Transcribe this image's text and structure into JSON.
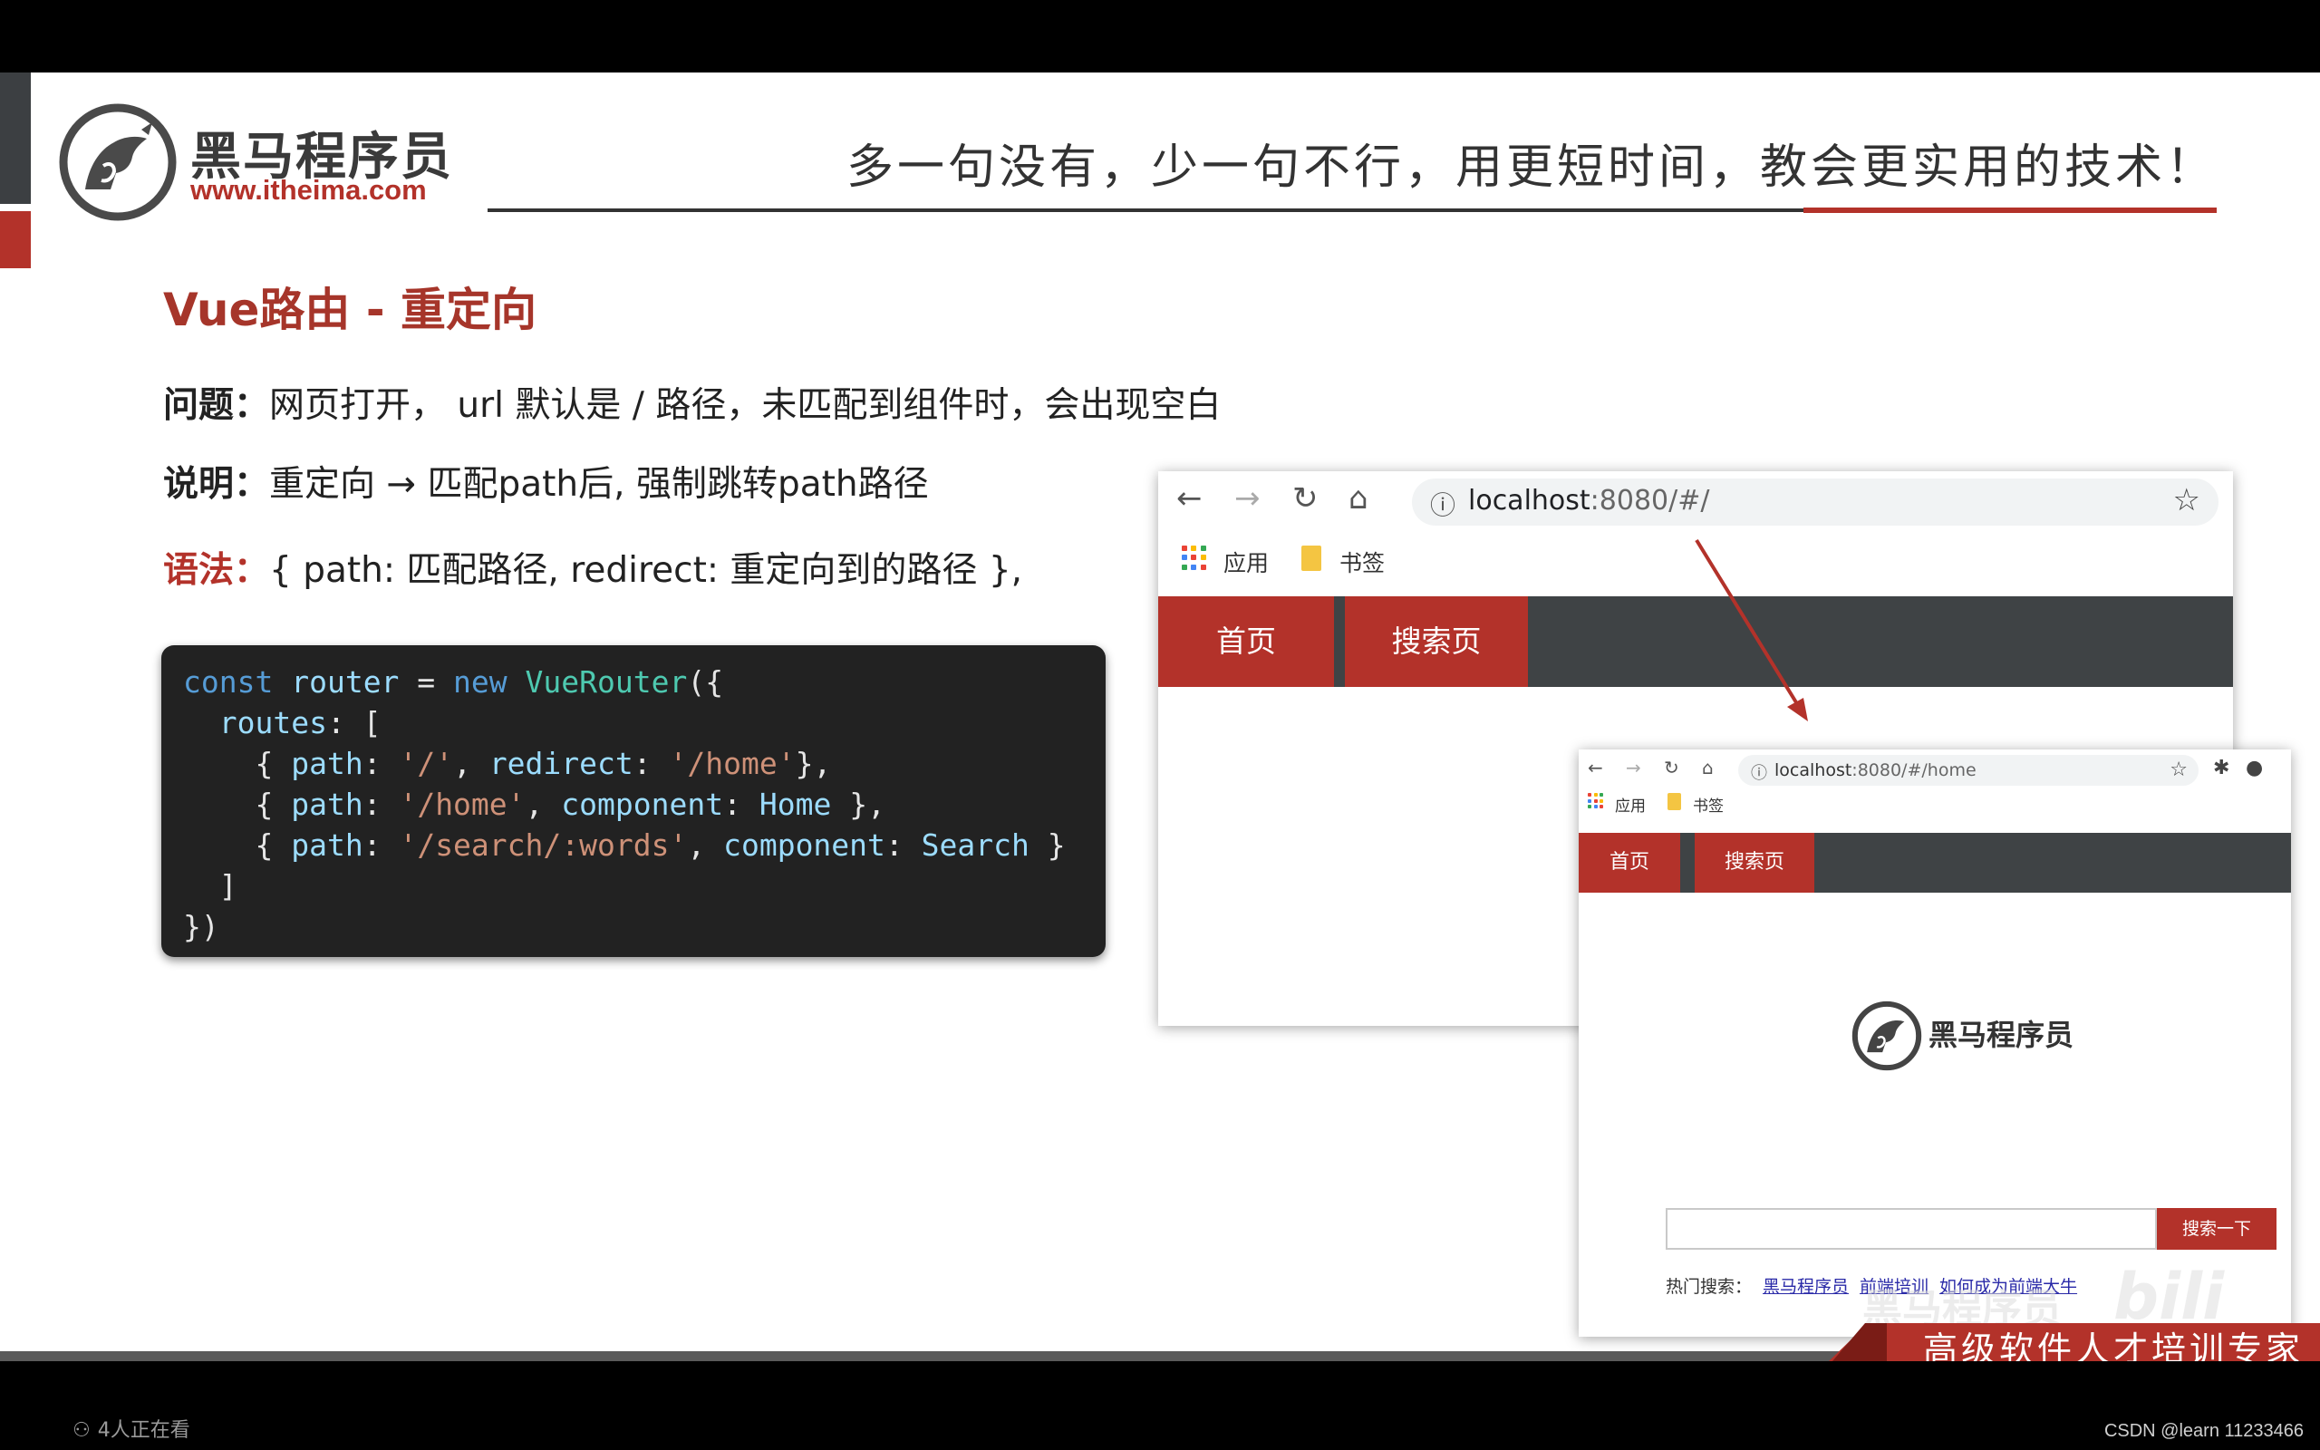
{
  "header": {
    "logo_name": "黑马程序员",
    "logo_url": "www.itheima.com",
    "slogan": "多一句没有，少一句不行，用更短时间，教会更实用的技术！"
  },
  "slide": {
    "title": "Vue路由 - 重定向",
    "problem_label": "问题：",
    "problem_text": "网页打开， url 默认是 / 路径，未匹配到组件时，会出现空白",
    "note_label": "说明：",
    "note_text": "重定向 → 匹配path后, 强制跳转path路径",
    "syntax_label": "语法：",
    "syntax_text": "{ path: 匹配路径, redirect: 重定向到的路径 },"
  },
  "code": {
    "kw_const": "const",
    "var_router": "router",
    "op_eq": " = ",
    "kw_new": "new",
    "cls_vuerouter": "VueRouter",
    "open": "({",
    "routes_key": "routes",
    "routes_open": ": [",
    "path_key": "path",
    "redirect_key": "redirect",
    "component_key": "component",
    "str_root": "'/'",
    "str_home": "'/home'",
    "str_search": "'/search/:words'",
    "comp_home": "Home",
    "comp_search": "Search",
    "close_arr": "]",
    "close_all": "})"
  },
  "browser1": {
    "url_host": "localhost",
    "url_rest": ":8080/#/",
    "bookmark_apps": "应用",
    "bookmark_folder": "书签",
    "tab_home": "首页",
    "tab_search": "搜索页"
  },
  "browser2": {
    "url_host": "localhost",
    "url_rest": ":8080/#/home",
    "bookmark_apps": "应用",
    "bookmark_folder": "书签",
    "tab_home": "首页",
    "tab_search": "搜索页",
    "logo_name": "黑马程序员",
    "search_button": "搜索一下",
    "hot_label": "热门搜索：",
    "hot_links": [
      "黑马程序员",
      "前端培训",
      "如何成为前端大牛"
    ]
  },
  "footer": {
    "banner": "高级软件人才培训专家",
    "viewers": "4人正在看",
    "watermark": "黑马程序员",
    "csdn": "CSDN @learn 11233466"
  },
  "colors": {
    "brand_red": "#b3322a",
    "nav_dark": "#3f4345",
    "code_bg": "#222222"
  },
  "icons": [
    "back-arrow-icon",
    "forward-arrow-icon",
    "reload-icon",
    "home-icon",
    "info-icon",
    "star-icon",
    "apps-grid-icon",
    "folder-icon",
    "puzzle-icon",
    "profile-icon",
    "viewers-icon"
  ]
}
